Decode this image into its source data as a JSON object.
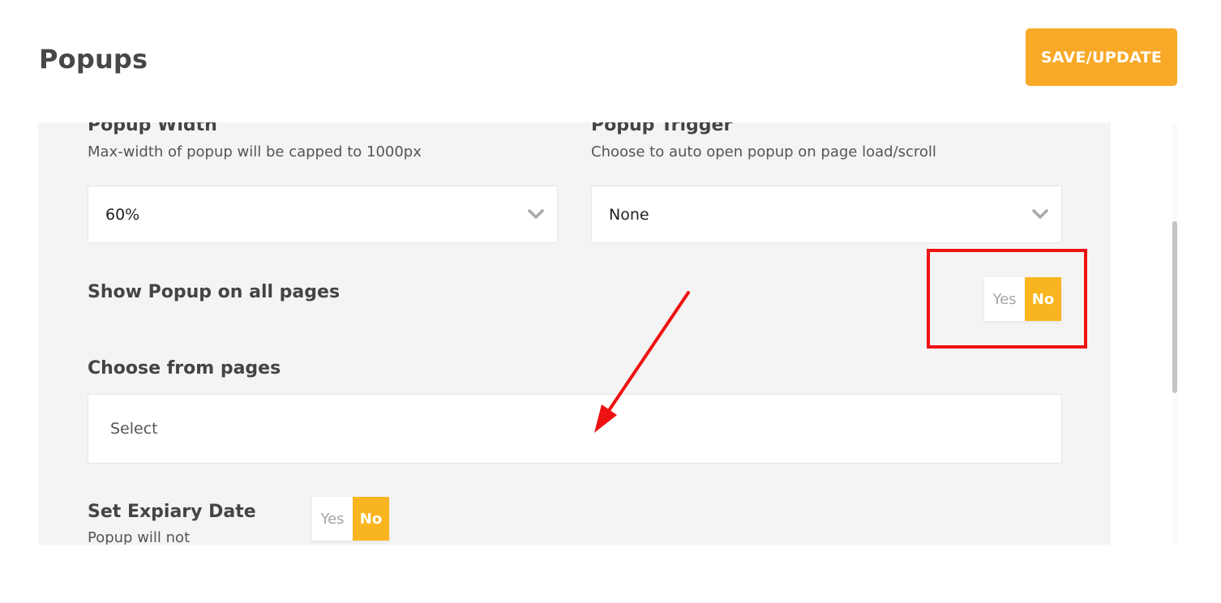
{
  "header": {
    "title": "Popups",
    "save_label": "SAVE/UPDATE"
  },
  "popup_width": {
    "label": "Popup Width",
    "help": "Max-width of popup will be capped to 1000px",
    "value": "60%"
  },
  "popup_trigger": {
    "label": "Popup Trigger",
    "help": "Choose to auto open popup on page load/scroll",
    "value": "None"
  },
  "show_all_pages": {
    "label": "Show Popup on all pages",
    "yes": "Yes",
    "no": "No",
    "selected": "No"
  },
  "choose_pages": {
    "label": "Choose from pages",
    "placeholder": "Select"
  },
  "expiry": {
    "label": "Set Expiary Date",
    "help": "Popup will not",
    "yes": "Yes",
    "no": "No",
    "selected": "No"
  },
  "annotation": {
    "highlight_color": "#ee1111"
  },
  "colors": {
    "accent": "#f8a928",
    "toggle_active": "#f9b51f",
    "panel_bg": "#f4f4f4"
  }
}
